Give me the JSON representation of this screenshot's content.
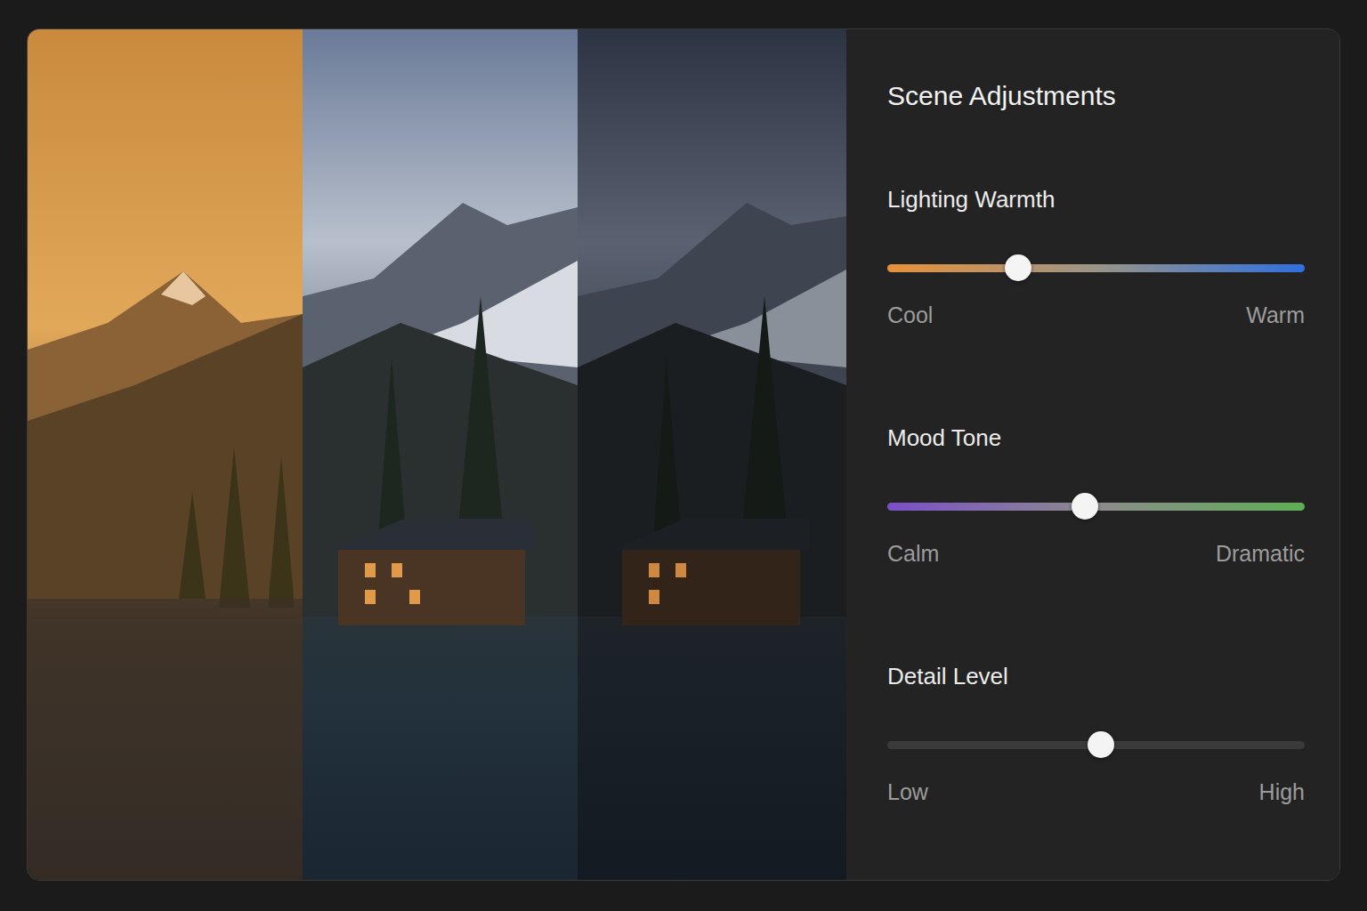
{
  "panel": {
    "title": "Scene Adjustments"
  },
  "sliders": [
    {
      "label": "Lighting Warmth",
      "level": 0.314,
      "min_label": "Cool",
      "max_label": "Warm",
      "colors": [
        "#e8913a",
        "#9a9488",
        "#2f6fe0"
      ]
    },
    {
      "label": "Mood Tone",
      "level": 0.473,
      "min_label": "Calm",
      "max_label": "Dramatic",
      "colors": [
        "#7b4fc9",
        "#8c8c8c",
        "#5fae55"
      ]
    },
    {
      "label": "Detail Level",
      "level": 0.512,
      "min_label": "Low",
      "max_label": "High",
      "colors": [
        "#3a3a3a",
        "#3a3a3a",
        "#3a3a3a"
      ]
    }
  ]
}
